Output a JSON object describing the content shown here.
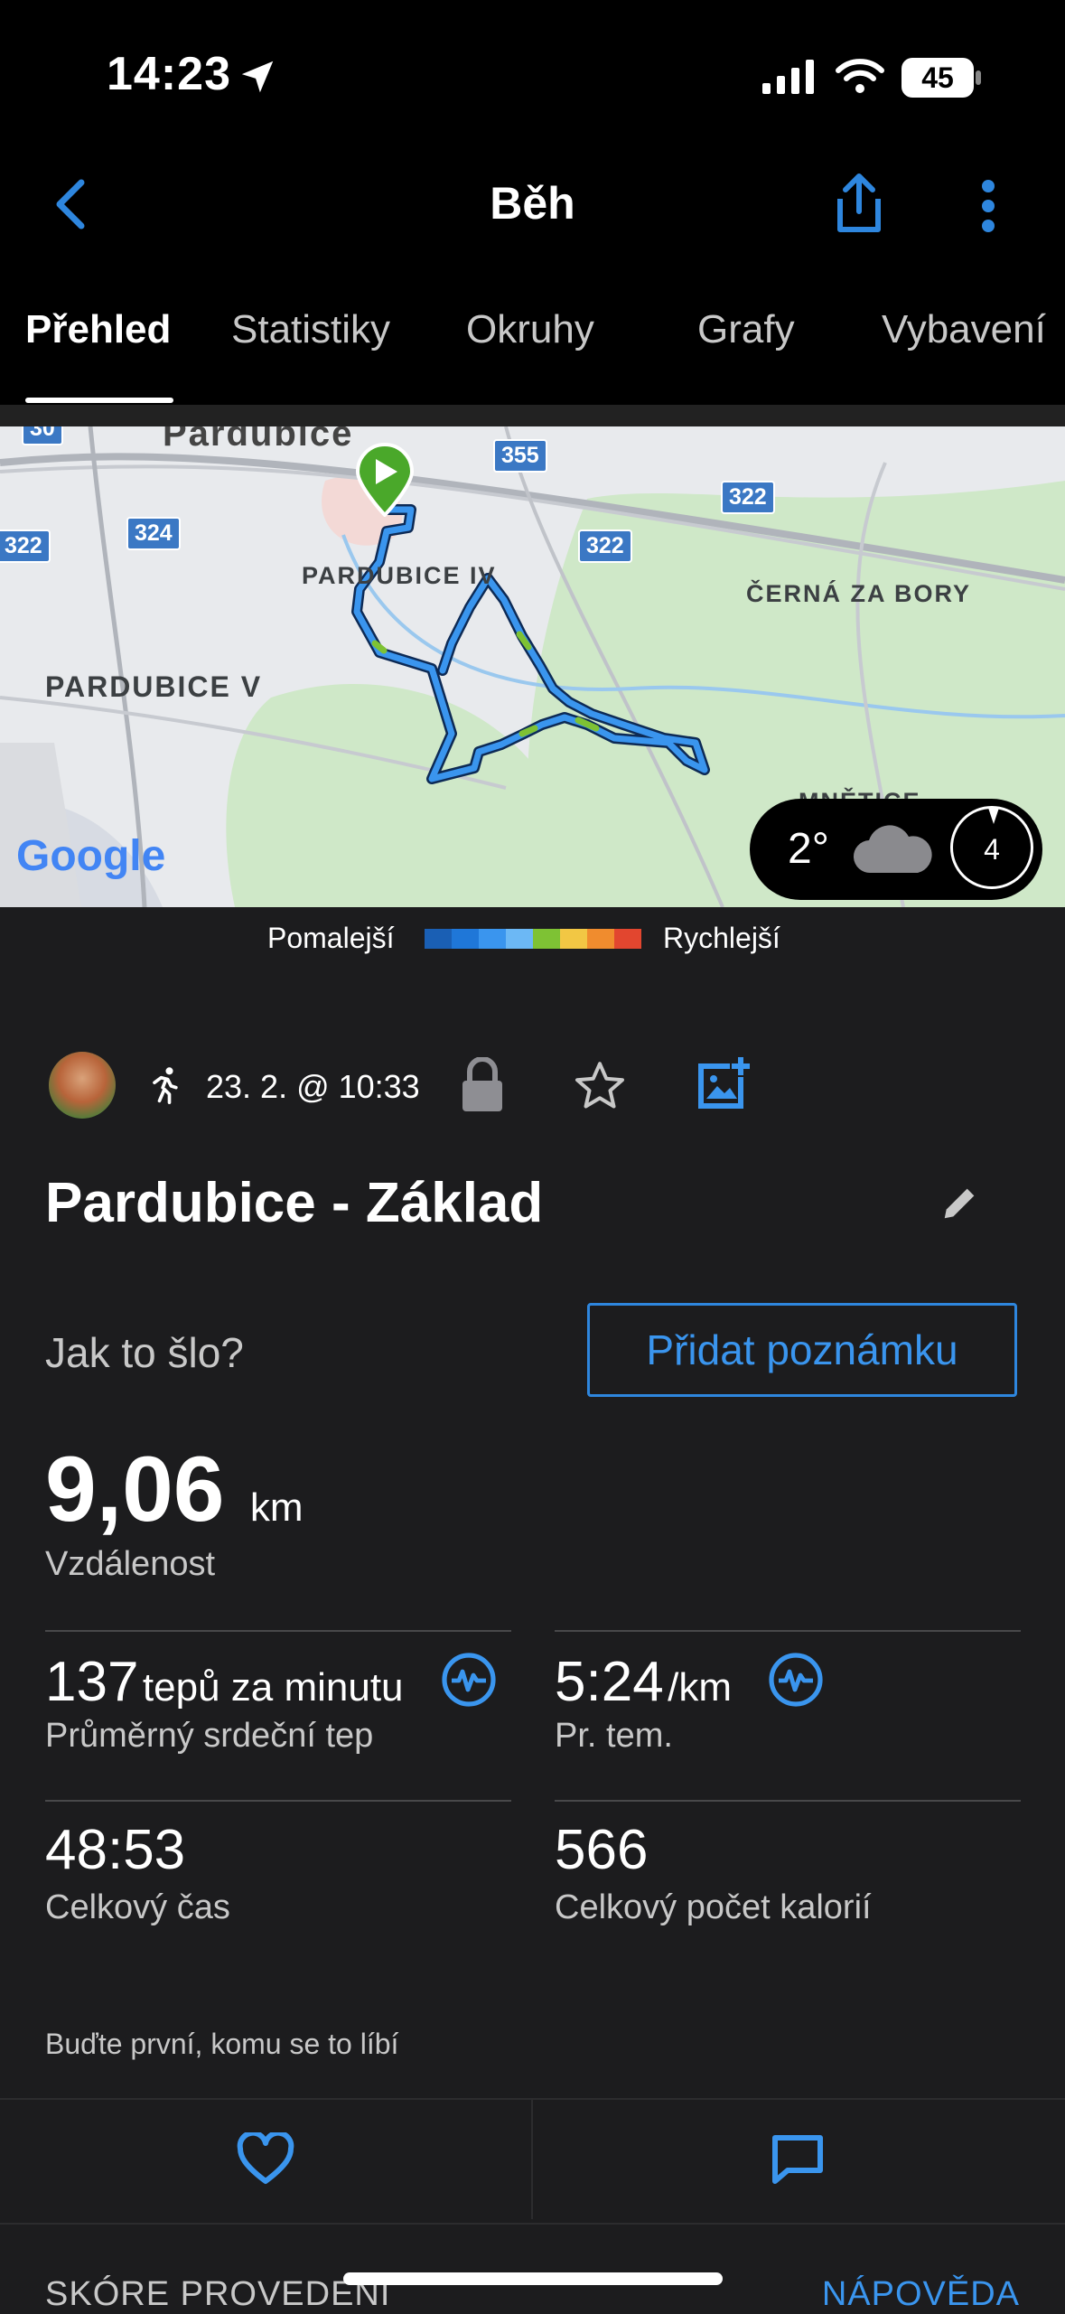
{
  "status": {
    "time": "14:23",
    "battery": "45"
  },
  "header": {
    "title": "Běh"
  },
  "tabs": [
    "Přehled",
    "Statistiky",
    "Okruhy",
    "Grafy",
    "Vybavení"
  ],
  "map": {
    "labels": [
      "PARDUBICE IV",
      "PARDUBICE V",
      "ČERNÁ ZA BORY",
      "MNĚTICE",
      "Pardubice"
    ],
    "roads": [
      "355",
      "322",
      "324",
      "322",
      "322",
      "30"
    ],
    "google": "Google",
    "weather_temp": "2°",
    "wind": "4"
  },
  "legend": {
    "slower": "Pomalejší",
    "faster": "Rychlejší",
    "colors": [
      "#1a5fb4",
      "#1f77d8",
      "#3a95ee",
      "#6cb8f5",
      "#7ec234",
      "#f2c744",
      "#f08c2e",
      "#e2462f"
    ]
  },
  "activity": {
    "datetime": "23. 2. @ 10:33",
    "title": "Pardubice - Základ",
    "question": "Jak to šlo?",
    "add_note": "Přidat poznámku",
    "distance_value": "9,06",
    "distance_unit": "km",
    "distance_label": "Vzdálenost",
    "hr_value": "137",
    "hr_unit": "tepů za minutu",
    "hr_label": "Průměrný srdeční tep",
    "pace_value": "5:24",
    "pace_unit": "/km",
    "pace_label": "Pr. tem.",
    "time_value": "48:53",
    "time_label": "Celkový čas",
    "cal_value": "566",
    "cal_label": "Celkový počet kalorií",
    "likes_text": "Buďte první, komu se to líbí"
  },
  "bottom": {
    "left": "SKÓRE PROVEDENÍ",
    "right": "NÁPOVĚDA"
  }
}
